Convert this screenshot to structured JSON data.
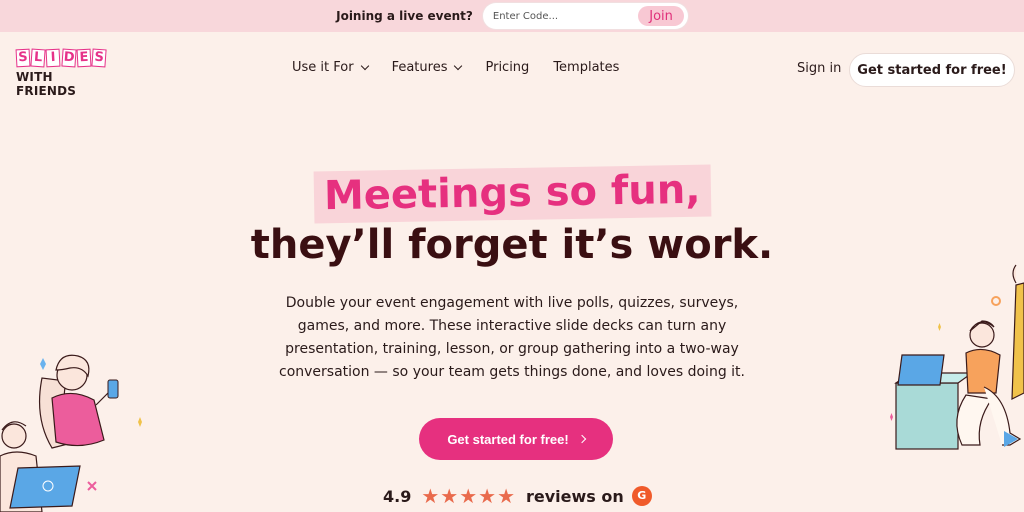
{
  "banner": {
    "label": "Joining a live event?",
    "code_placeholder": "Enter Code...",
    "join_label": "Join"
  },
  "logo": {
    "letters": [
      "S",
      "L",
      "I",
      "D",
      "E",
      "S"
    ],
    "bottom": "WITH FRIENDS"
  },
  "nav": {
    "items": [
      {
        "label": "Use it For",
        "dropdown": true
      },
      {
        "label": "Features",
        "dropdown": true
      },
      {
        "label": "Pricing",
        "dropdown": false
      },
      {
        "label": "Templates",
        "dropdown": false
      }
    ],
    "signin": "Sign in",
    "cta": "Get started for free!"
  },
  "hero": {
    "headline_1": "Meetings so fun,",
    "headline_2": "they’ll forget it’s work.",
    "subtext": "Double your event engagement with live polls, quizzes, surveys, games, and more. These interactive slide decks can turn any presentation, training, lesson, or group gathering into a two-way conversation — so your team gets things done, and loves doing it.",
    "cta": "Get started for free!"
  },
  "rating": {
    "score": "4.9",
    "stars": "★★★★★",
    "label": "reviews on",
    "g2": "G"
  },
  "colors": {
    "accent": "#e6307f",
    "banner_bg": "#f8d7db",
    "page_bg": "#fcf0ea",
    "headline_dark": "#3a0f12"
  }
}
